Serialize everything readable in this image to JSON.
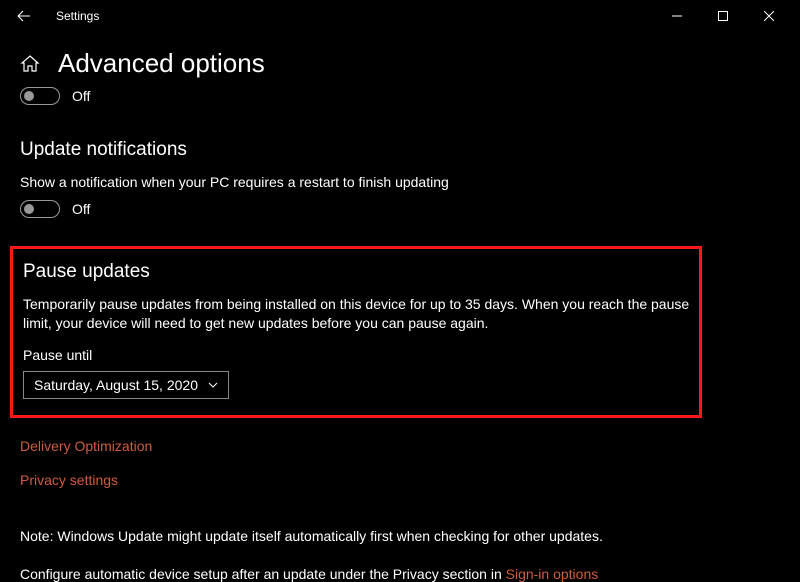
{
  "window": {
    "title": "Settings"
  },
  "page": {
    "title": "Advanced options",
    "main_toggle": {
      "label": "Off"
    }
  },
  "update_notifications": {
    "title": "Update notifications",
    "description": "Show a notification when your PC requires a restart to finish updating",
    "toggle_label": "Off"
  },
  "pause_updates": {
    "title": "Pause updates",
    "description": "Temporarily pause updates from being installed on this device for up to 35 days. When you reach the pause limit, your device will need to get new updates before you can pause again.",
    "pause_until_label": "Pause until",
    "dropdown_value": "Saturday, August 15, 2020"
  },
  "links": {
    "delivery_optimization": "Delivery Optimization",
    "privacy_settings": "Privacy settings"
  },
  "footer": {
    "note": "Note: Windows Update might update itself automatically first when checking for other updates.",
    "config_prefix": "Configure automatic device setup after an update under the Privacy section in ",
    "signin_link": "Sign-in options"
  }
}
